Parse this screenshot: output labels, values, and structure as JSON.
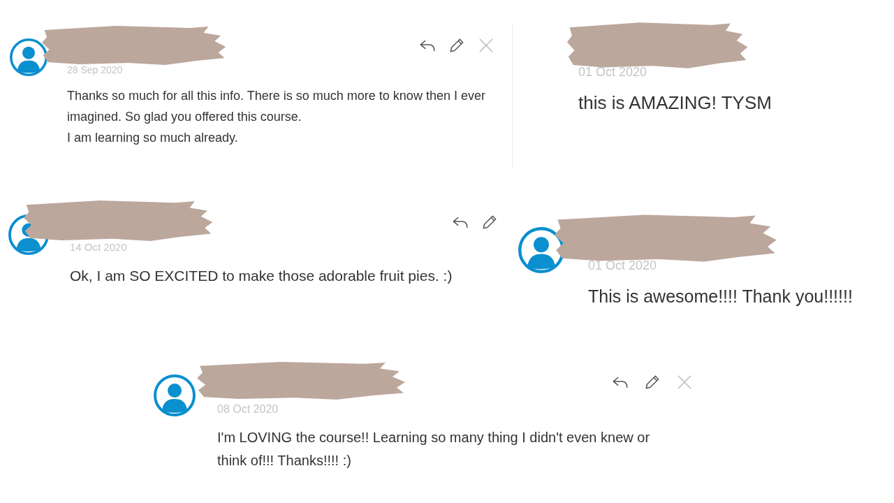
{
  "comments": [
    {
      "avatar": true,
      "name_redacted": true,
      "date": "28 Sep 2020",
      "text": "Thanks so much for all this info. There is so much more to know then I ever imagined. So glad you offered this course.\nI am learning so much already.",
      "actions": [
        {
          "kind": "reply"
        },
        {
          "kind": "edit"
        },
        {
          "kind": "delete"
        }
      ]
    },
    {
      "avatar": false,
      "name_redacted": true,
      "date": "01 Oct 2020",
      "text": "this is AMAZING! TYSM"
    },
    {
      "avatar": true,
      "name_redacted": true,
      "date": "14 Oct 2020",
      "text": "Ok, I am SO EXCITED to make those adorable fruit pies. :)",
      "actions": [
        {
          "kind": "reply"
        },
        {
          "kind": "edit"
        }
      ]
    },
    {
      "avatar": true,
      "name_redacted": true,
      "date": "01 Oct 2020",
      "text": "This is awesome!!!! Thank you!!!!!!"
    },
    {
      "avatar": true,
      "name_redacted": true,
      "date": "08 Oct 2020",
      "text": "I'm LOVING the course!! Learning so many thing I didn't even knew or think of!!! Thanks!!!! :)",
      "actions": [
        {
          "kind": "reply"
        },
        {
          "kind": "edit"
        },
        {
          "kind": "delete"
        }
      ]
    }
  ]
}
